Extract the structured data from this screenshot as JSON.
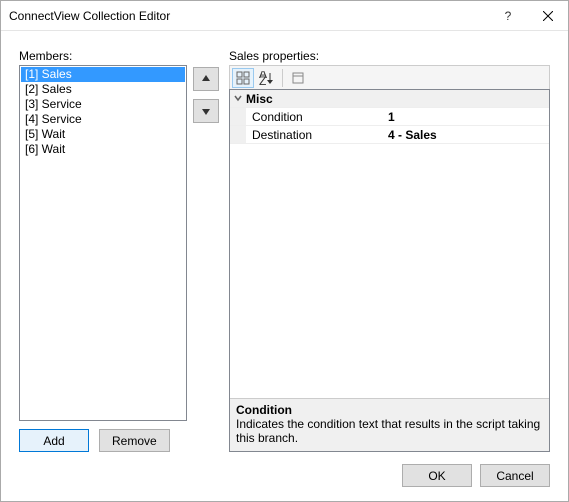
{
  "title": "ConnectView Collection Editor",
  "left": {
    "label": "Members:",
    "items": [
      {
        "label": "[1] Sales",
        "selected": true
      },
      {
        "label": "[2] Sales",
        "selected": false
      },
      {
        "label": "[3] Service",
        "selected": false
      },
      {
        "label": "[4] Service",
        "selected": false
      },
      {
        "label": "[5] Wait",
        "selected": false
      },
      {
        "label": "[6] Wait",
        "selected": false
      }
    ],
    "buttons": {
      "add": "Add",
      "remove": "Remove"
    }
  },
  "right": {
    "label": "Sales properties:",
    "toolbar": {
      "categorized": "categorized-icon",
      "alphabetical": "alphabetical-sort-icon",
      "property_pages": "property-pages-icon"
    },
    "grid": {
      "category": "Misc",
      "rows": [
        {
          "name": "Condition",
          "value": "1"
        },
        {
          "name": "Destination",
          "value": "4 - Sales"
        }
      ]
    },
    "help": {
      "name": "Condition",
      "description": "Indicates the condition text that results in the script taking this branch."
    }
  },
  "footer": {
    "ok": "OK",
    "cancel": "Cancel"
  }
}
